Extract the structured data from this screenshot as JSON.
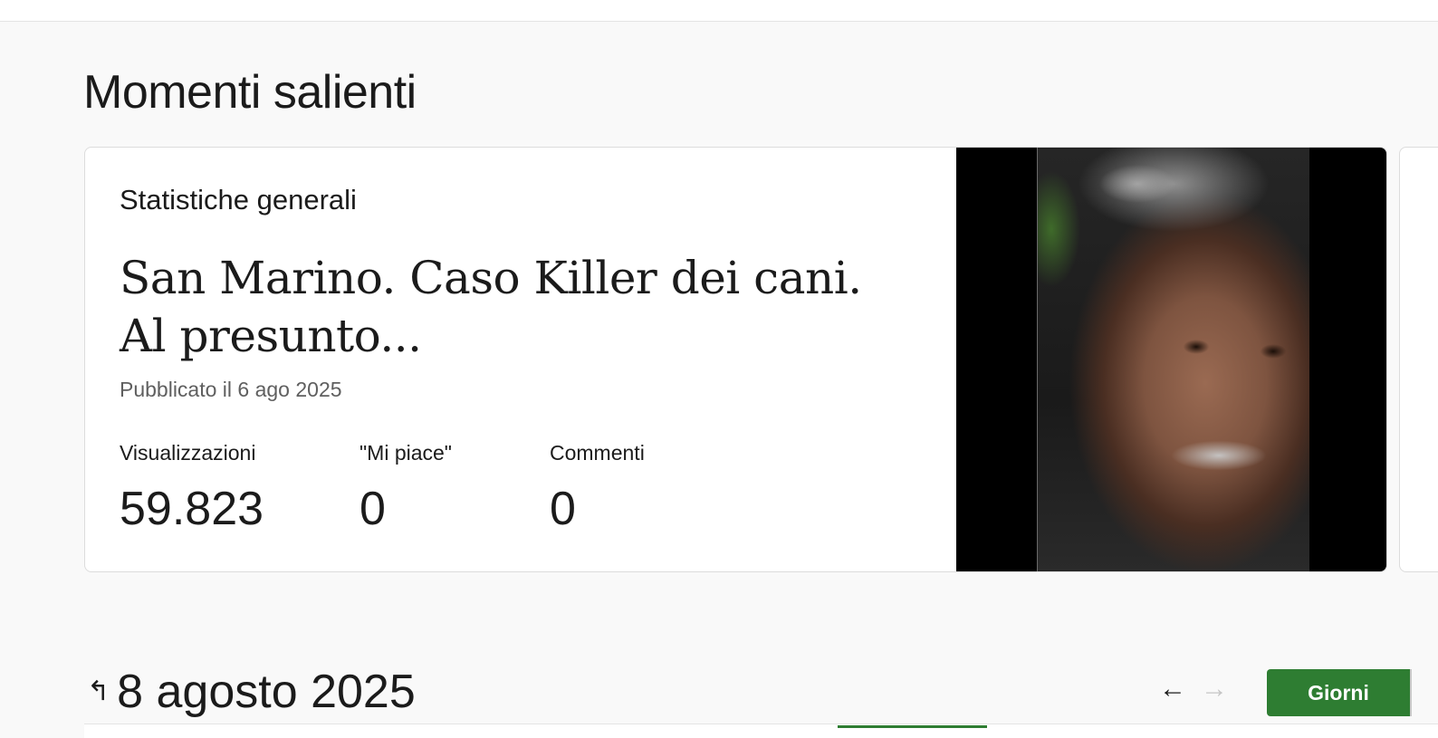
{
  "section": {
    "title": "Momenti salienti"
  },
  "highlight_card": {
    "label": "Statistiche generali",
    "post_title": "San Marino. Caso Killer dei cani. Al presunto...",
    "published": "Pubblicato il 6 ago 2025",
    "stats": [
      {
        "label": "Visualizzazioni",
        "value": "59.823"
      },
      {
        "label": "\"Mi piace\"",
        "value": "0"
      },
      {
        "label": "Commenti",
        "value": "0"
      }
    ]
  },
  "date_nav": {
    "date": "8 agosto 2025",
    "back_icon": "↰",
    "prev_icon": "←",
    "next_icon": "→",
    "period_button": "Giorni"
  },
  "colors": {
    "accent_green": "#2e7d32",
    "background": "#f9f9f9",
    "card": "#ffffff"
  }
}
